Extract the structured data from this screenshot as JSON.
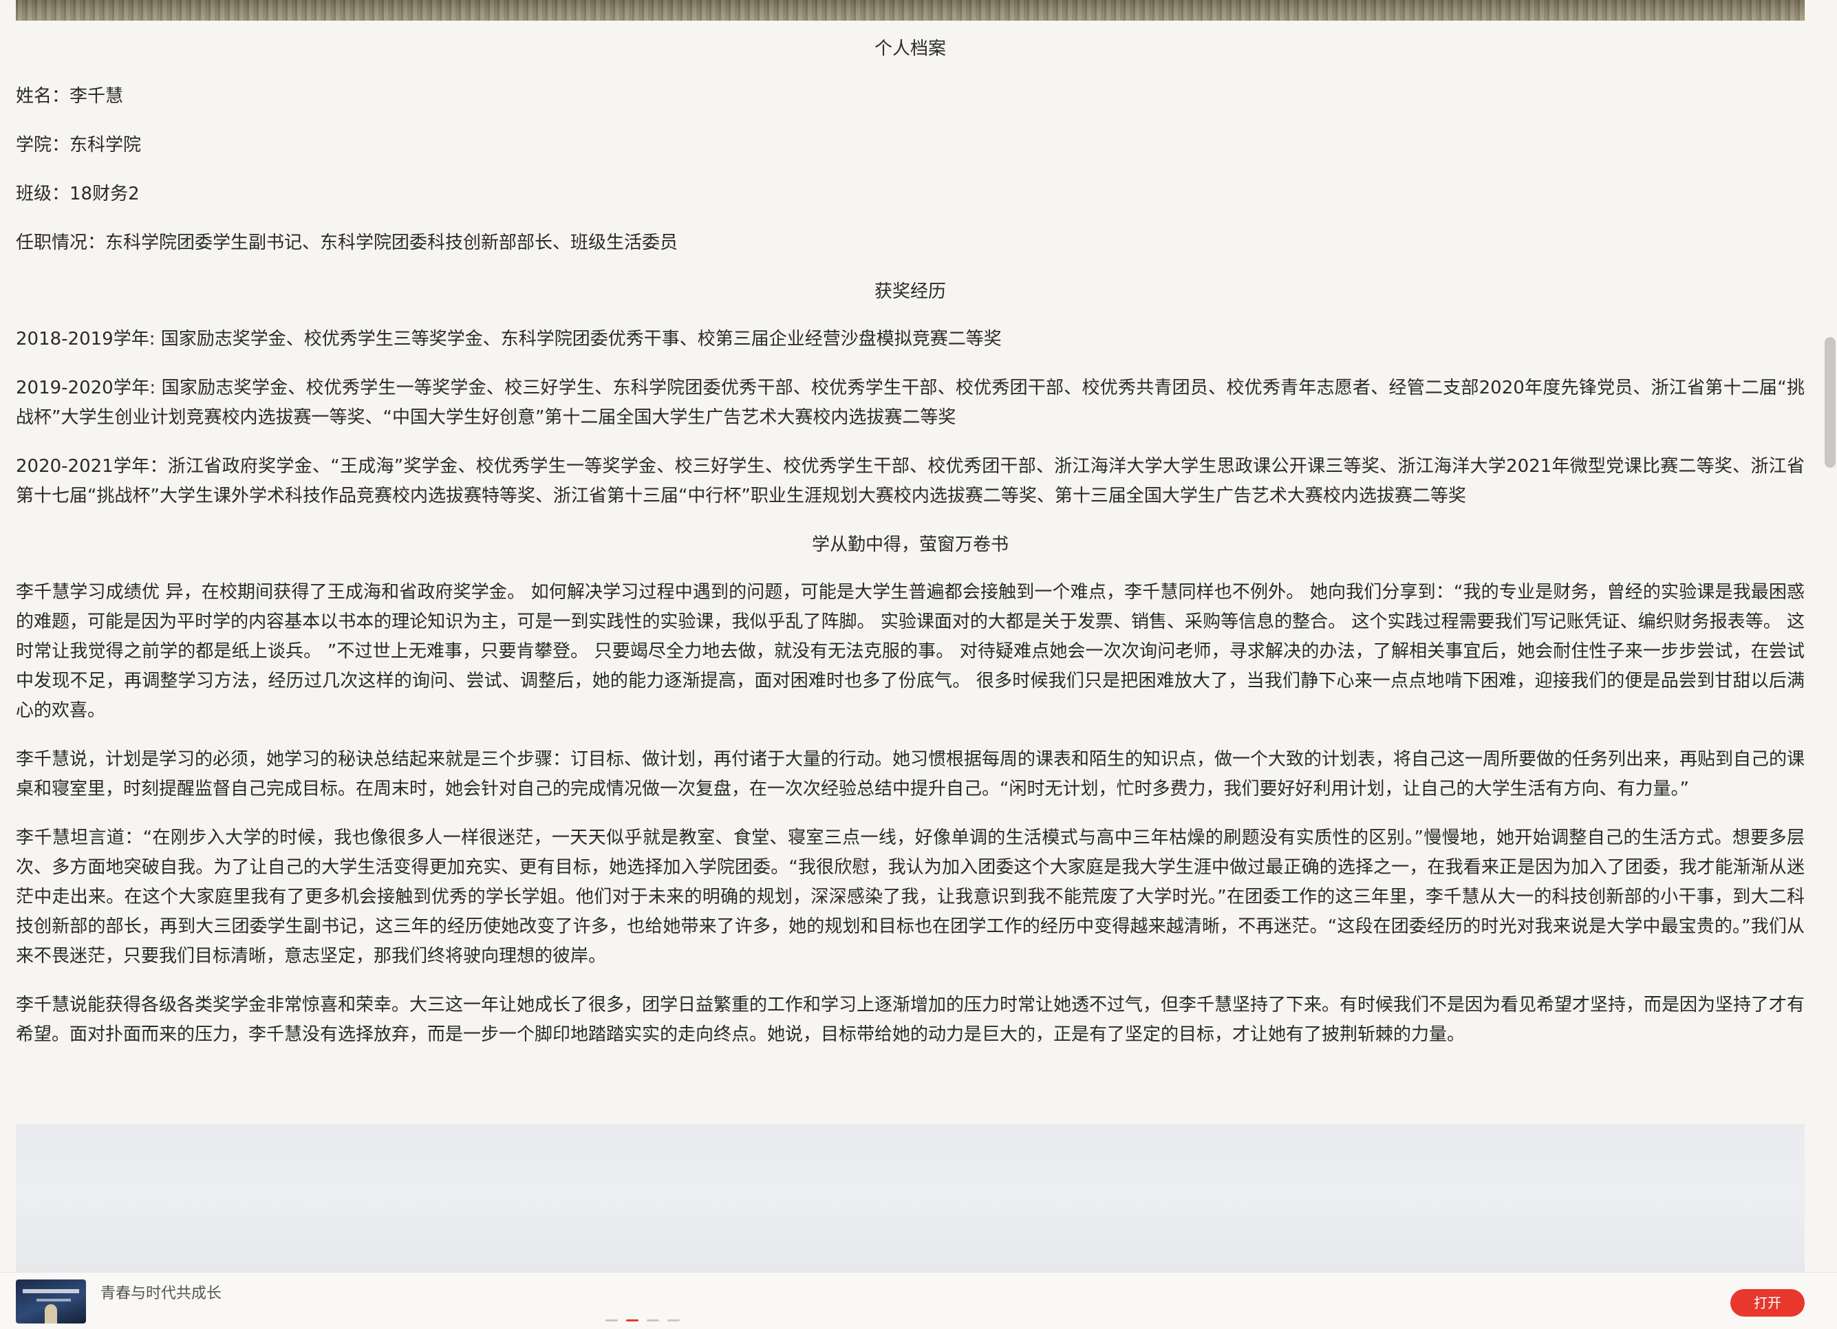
{
  "article": {
    "profile_heading": "个人档案",
    "name_line": "姓名：李千慧",
    "college_line": "学院：东科学院",
    "class_line": "班级：18财务2",
    "position_line": "任职情况：东科学院团委学生副书记、东科学院团委科技创新部部长、班级生活委员",
    "awards_heading": "获奖经历",
    "awards": [
      "2018-2019学年: 国家励志奖学金、校优秀学生三等奖学金、东科学院团委优秀干事、校第三届企业经营沙盘模拟竞赛二等奖",
      "2019-2020学年: 国家励志奖学金、校优秀学生一等奖学金、校三好学生、东科学院团委优秀干部、校优秀学生干部、校优秀团干部、校优秀共青团员、校优秀青年志愿者、经管二支部2020年度先锋党员、浙江省第十二届“挑战杯”大学生创业计划竞赛校内选拔赛一等奖、“中国大学生好创意”第十二届全国大学生广告艺术大赛校内选拔赛二等奖",
      "2020-2021学年：浙江省政府奖学金、“王成海”奖学金、校优秀学生一等奖学金、校三好学生、校优秀学生干部、校优秀团干部、浙江海洋大学大学生思政课公开课三等奖、浙江海洋大学2021年微型党课比赛二等奖、浙江省第十七届“挑战杯”大学生课外学术科技作品竞赛校内选拔赛特等奖、浙江省第十三届“中行杯”职业生涯规划大赛校内选拔赛二等奖、第十三届全国大学生广告艺术大赛校内选拔赛二等奖"
    ],
    "study_heading": "学从勤中得，萤窗万卷书",
    "paragraphs": [
      "李千慧学习成绩优 异，在校期间获得了王成海和省政府奖学金。 如何解决学习过程中遇到的问题，可能是大学生普遍都会接触到一个难点，李千慧同样也不例外。 她向我们分享到：“我的专业是财务，曾经的实验课是我最困惑的难题，可能是因为平时学的内容基本以书本的理论知识为主，可是一到实践性的实验课，我似乎乱了阵脚。 实验课面对的大都是关于发票、销售、采购等信息的整合。 这个实践过程需要我们写记账凭证、编织财务报表等。 这时常让我觉得之前学的都是纸上谈兵。 ”不过世上无难事，只要肯攀登。 只要竭尽全力地去做，就没有无法克服的事。 对待疑难点她会一次次询问老师，寻求解决的办法，了解相关事宜后，她会耐住性子来一步步尝试，在尝试中发现不足，再调整学习方法，经历过几次这样的询问、尝试、调整后，她的能力逐渐提高，面对困难时也多了份底气。 很多时候我们只是把困难放大了，当我们静下心来一点点地啃下困难，迎接我们的便是品尝到甘甜以后满心的欢喜。",
      "李千慧说，计划是学习的必须，她学习的秘诀总结起来就是三个步骤：订目标、做计划，再付诸于大量的行动。她习惯根据每周的课表和陌生的知识点，做一个大致的计划表，将自己这一周所要做的任务列出来，再贴到自己的课桌和寝室里，时刻提醒监督自己完成目标。在周末时，她会针对自己的完成情况做一次复盘，在一次次经验总结中提升自己。“闲时无计划，忙时多费力，我们要好好利用计划，让自己的大学生活有方向、有力量。”",
      "李千慧坦言道：“在刚步入大学的时候，我也像很多人一样很迷茫，一天天似乎就是教室、食堂、寝室三点一线，好像单调的生活模式与高中三年枯燥的刷题没有实质性的区别。”慢慢地，她开始调整自己的生活方式。想要多层次、多方面地突破自我。为了让自己的大学生活变得更加充实、更有目标，她选择加入学院团委。“我很欣慰，我认为加入团委这个大家庭是我大学生涯中做过最正确的选择之一，在我看来正是因为加入了团委，我才能渐渐从迷茫中走出来。在这个大家庭里我有了更多机会接触到优秀的学长学姐。他们对于未来的明确的规划，深深感染了我，让我意识到我不能荒废了大学时光。”在团委工作的这三年里，李千慧从大一的科技创新部的小干事，到大二科技创新部的部长，再到大三团委学生副书记，这三年的经历使她改变了许多，也给她带来了许多，她的规划和目标也在团学工作的经历中变得越来越清晰，不再迷茫。“这段在团委经历的时光对我来说是大学中最宝贵的。”我们从来不畏迷茫，只要我们目标清晰，意志坚定，那我们终将驶向理想的彼岸。",
      "李千慧说能获得各级各类奖学金非常惊喜和荣幸。大三这一年让她成长了很多，团学日益繁重的工作和学习上逐渐增加的压力时常让她透不过气，但李千慧坚持了下来。有时候我们不是因为看见希望才坚持，而是因为坚持了才有希望。面对扑面而来的压力，李千慧没有选择放弃，而是一步一个脚印地踏踏实实的走向终点。她说，目标带给她的动力是巨大的，正是有了坚定的目标，才让她有了披荆斩棘的力量。"
    ]
  },
  "bottom_bar": {
    "title": "青春与时代共成长",
    "open_label": "打开",
    "pager_active_index": 1,
    "pager_count": 4
  },
  "colors": {
    "accent": "#e8372c",
    "background": "#f7f5f1",
    "text": "#2a2a2a"
  }
}
